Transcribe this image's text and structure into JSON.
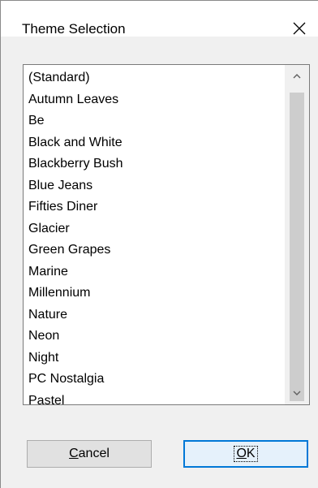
{
  "dialog": {
    "title": "Theme Selection",
    "close_icon": "close-icon"
  },
  "themes": {
    "items": [
      "(Standard)",
      "Autumn Leaves",
      "Be",
      "Black and White",
      "Blackberry Bush",
      "Blue Jeans",
      "Fifties Diner",
      "Glacier",
      "Green Grapes",
      "Marine",
      "Millennium",
      "Nature",
      "Neon",
      "Night",
      "PC Nostalgia",
      "Pastel"
    ]
  },
  "scrollbar": {
    "up_icon": "chevron-up-icon",
    "down_icon": "chevron-down-icon"
  },
  "buttons": {
    "cancel": {
      "mnemonic": "C",
      "rest": "ancel"
    },
    "ok": {
      "mnemonic": "O",
      "rest": "K"
    }
  },
  "colors": {
    "focus_border": "#0078d7",
    "thumb": "#cdcdcd"
  }
}
